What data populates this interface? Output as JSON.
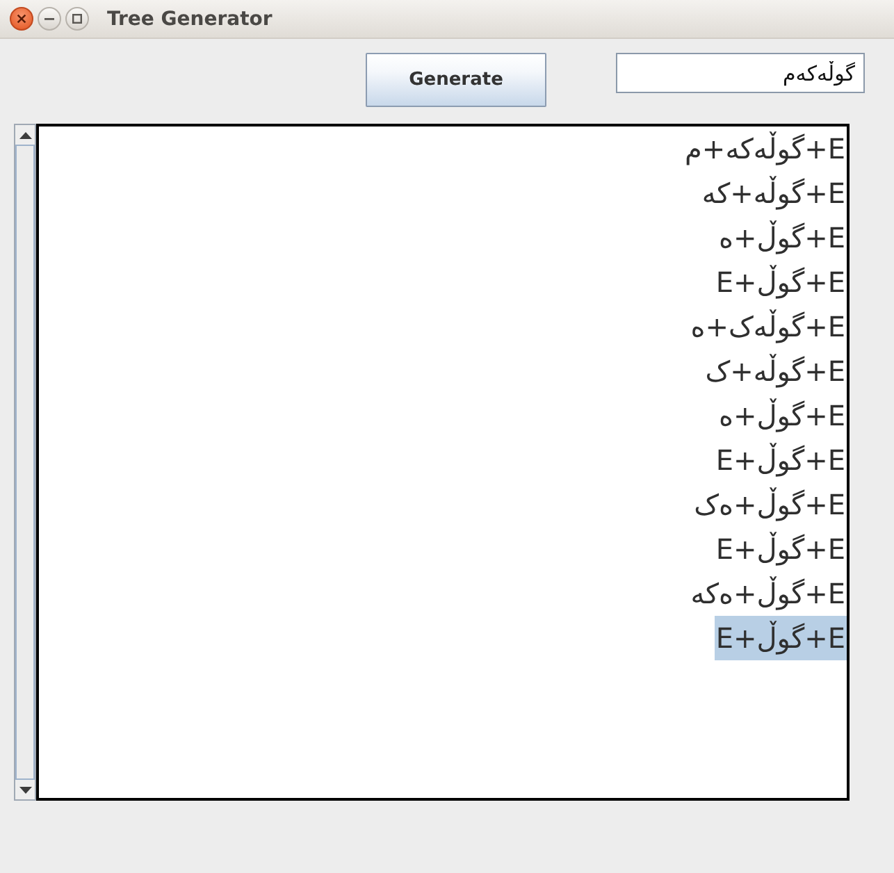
{
  "window": {
    "title": "Tree Generator"
  },
  "toolbar": {
    "generate_button": "Generate",
    "input": {
      "value": "گوڵەکەم"
    }
  },
  "tree_list": {
    "items": [
      {
        "label": "E+گوڵەکە+م",
        "selected": false
      },
      {
        "label": "E+گوڵە+کە",
        "selected": false
      },
      {
        "label": "E+گوڵ+ە",
        "selected": false
      },
      {
        "label": "E+گوڵ+E",
        "selected": false
      },
      {
        "label": "E+گوڵەک+ە",
        "selected": false
      },
      {
        "label": "E+گوڵە+ک",
        "selected": false
      },
      {
        "label": "E+گوڵ+ە",
        "selected": false
      },
      {
        "label": "E+گوڵ+E",
        "selected": false
      },
      {
        "label": "E+گوڵ+ەک",
        "selected": false
      },
      {
        "label": "E+گوڵ+E",
        "selected": false
      },
      {
        "label": "E+گوڵ+ەکە",
        "selected": false
      },
      {
        "label": "E+گوڵ+E",
        "selected": true
      }
    ]
  }
}
